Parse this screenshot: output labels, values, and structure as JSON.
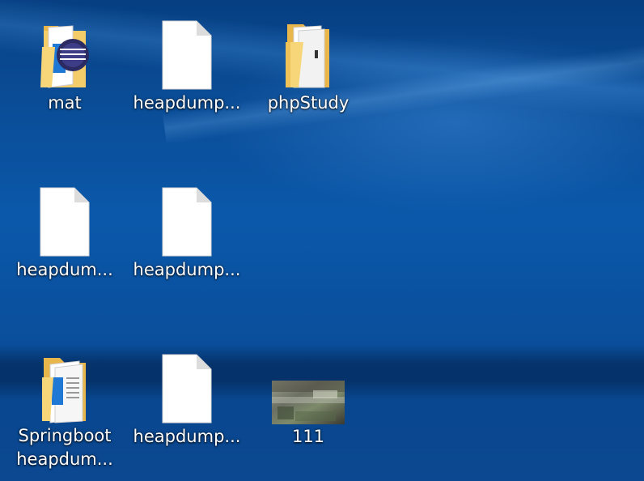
{
  "desktop": {
    "icons": [
      {
        "label": "mat",
        "type": "folder",
        "icon": "folder-with-app-icon"
      },
      {
        "label": "heapdump...",
        "type": "file",
        "icon": "blank-file-icon"
      },
      {
        "label": "phpStudy",
        "type": "folder",
        "icon": "folder-icon"
      },
      {
        "label": "heapdum...",
        "type": "file",
        "icon": "blank-file-icon"
      },
      {
        "label": "heapdump...",
        "type": "file",
        "icon": "blank-file-icon"
      },
      {
        "label_line1": "Springboot",
        "label_line2": "heapdum...",
        "type": "folder",
        "icon": "folder-with-docs-icon"
      },
      {
        "label": "heapdump...",
        "type": "file",
        "icon": "blank-file-icon"
      },
      {
        "label": "111",
        "type": "image",
        "icon": "image-thumbnail-icon"
      }
    ]
  }
}
